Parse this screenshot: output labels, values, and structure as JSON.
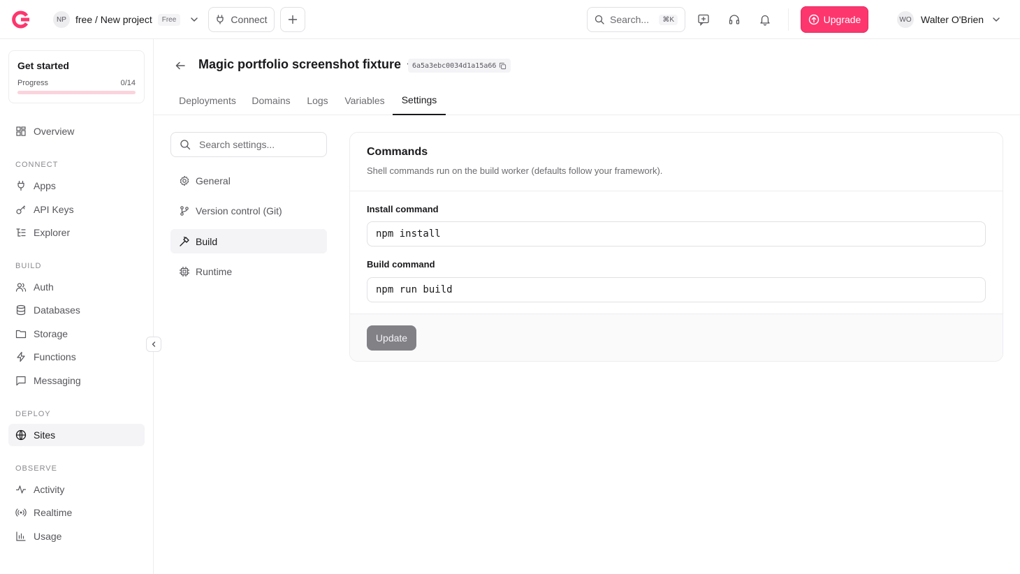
{
  "topbar": {
    "project_initials": "NP",
    "project_name": "free / New project",
    "plan_badge": "Free",
    "connect_label": "Connect",
    "search_placeholder": "Search...",
    "search_shortcut": "⌘K",
    "upgrade_label": "Upgrade",
    "user_initials": "WO",
    "user_name": "Walter O'Brien",
    "accent_color": "#fd366e"
  },
  "sidebar": {
    "get_started": {
      "title": "Get started",
      "progress_label": "Progress",
      "progress_value": "0/14",
      "progress_fraction": 0
    },
    "overview": "Overview",
    "sections": {
      "connect": "CONNECT",
      "build": "BUILD",
      "deploy": "DEPLOY",
      "observe": "OBSERVE"
    },
    "items": {
      "apps": "Apps",
      "api_keys": "API Keys",
      "explorer": "Explorer",
      "auth": "Auth",
      "databases": "Databases",
      "storage": "Storage",
      "functions": "Functions",
      "messaging": "Messaging",
      "sites": "Sites",
      "activity": "Activity",
      "realtime": "Realtime",
      "usage": "Usage"
    }
  },
  "page": {
    "title": "Magic portfolio screenshot fixture",
    "site_id": "6a5a3ebc0034d1a15a66",
    "tabs": [
      "Deployments",
      "Domains",
      "Logs",
      "Variables",
      "Settings"
    ],
    "active_tab": "Settings"
  },
  "settings_nav": {
    "search_placeholder": "Search settings...",
    "items": [
      "General",
      "Version control (Git)",
      "Build",
      "Runtime"
    ],
    "active": "Build"
  },
  "commands_card": {
    "title": "Commands",
    "description": "Shell commands run on the build worker (defaults follow your framework).",
    "install_label": "Install command",
    "install_value": "npm install",
    "build_label": "Build command",
    "build_value": "npm run build",
    "update_label": "Update"
  }
}
